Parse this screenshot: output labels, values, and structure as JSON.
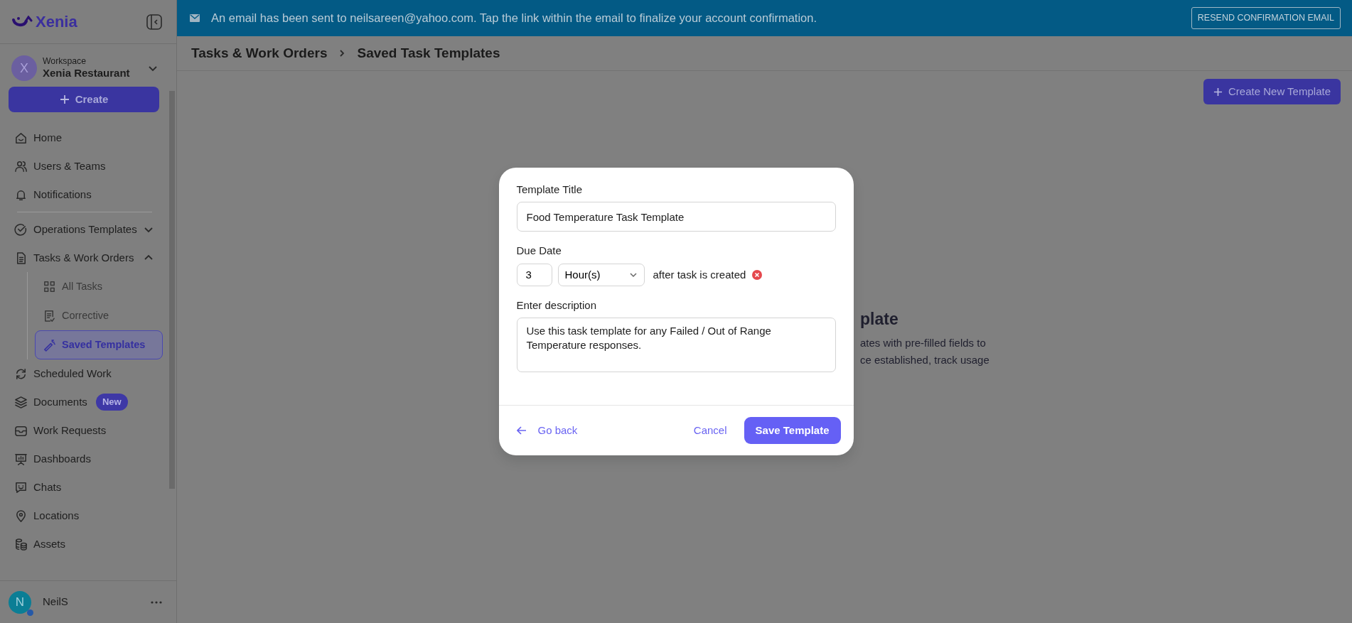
{
  "app": {
    "name": "Xenia"
  },
  "workspace": {
    "label": "Workspace",
    "name": "Xenia Restaurant",
    "initial": "X"
  },
  "create_button": {
    "label": "Create"
  },
  "sidebar": {
    "items": [
      {
        "label": "Home",
        "selected": false
      },
      {
        "label": "Users & Teams",
        "selected": false
      },
      {
        "label": "Notifications",
        "selected": false
      },
      {
        "label": "Operations Templates",
        "selected": false,
        "expanded": false
      },
      {
        "label": "Tasks & Work Orders",
        "selected": false,
        "expanded": true,
        "children": [
          {
            "label": "All Tasks",
            "selected": false
          },
          {
            "label": "Corrective",
            "selected": false
          },
          {
            "label": "Saved Templates",
            "selected": true
          }
        ]
      },
      {
        "label": "Scheduled Work",
        "selected": false
      },
      {
        "label": "Documents",
        "selected": false,
        "badge": "New"
      },
      {
        "label": "Work Requests",
        "selected": false
      },
      {
        "label": "Dashboards",
        "selected": false
      },
      {
        "label": "Chats",
        "selected": false
      },
      {
        "label": "Locations",
        "selected": false
      },
      {
        "label": "Assets",
        "selected": false
      }
    ]
  },
  "user": {
    "initial": "N",
    "name": "NeilS",
    "online": true
  },
  "banner": {
    "message": "An email has been sent to neilsareen@yahoo.com. Tap the link within the email to finalize your account confirmation.",
    "button": "RESEND CONFIRMATION EMAIL"
  },
  "breadcrumb": [
    "Tasks & Work Orders",
    "Saved Task Templates"
  ],
  "primary_action": "Create New Template",
  "background_fragments": {
    "heading": "plate",
    "lines": [
      "ates with pre-filled fields to",
      "ce established, track usage"
    ]
  },
  "modal": {
    "title_label": "Template Title",
    "title_value": "Food Temperature Task Template",
    "due_label": "Due Date",
    "due_amount": "3",
    "due_unit": "Hour(s)",
    "due_suffix": "after task is created",
    "description_label": "Enter description",
    "description_value": "Use this task template for any Failed / Out of Range Temperature responses.",
    "go_back": "Go back",
    "cancel": "Cancel",
    "save": "Save Template"
  }
}
